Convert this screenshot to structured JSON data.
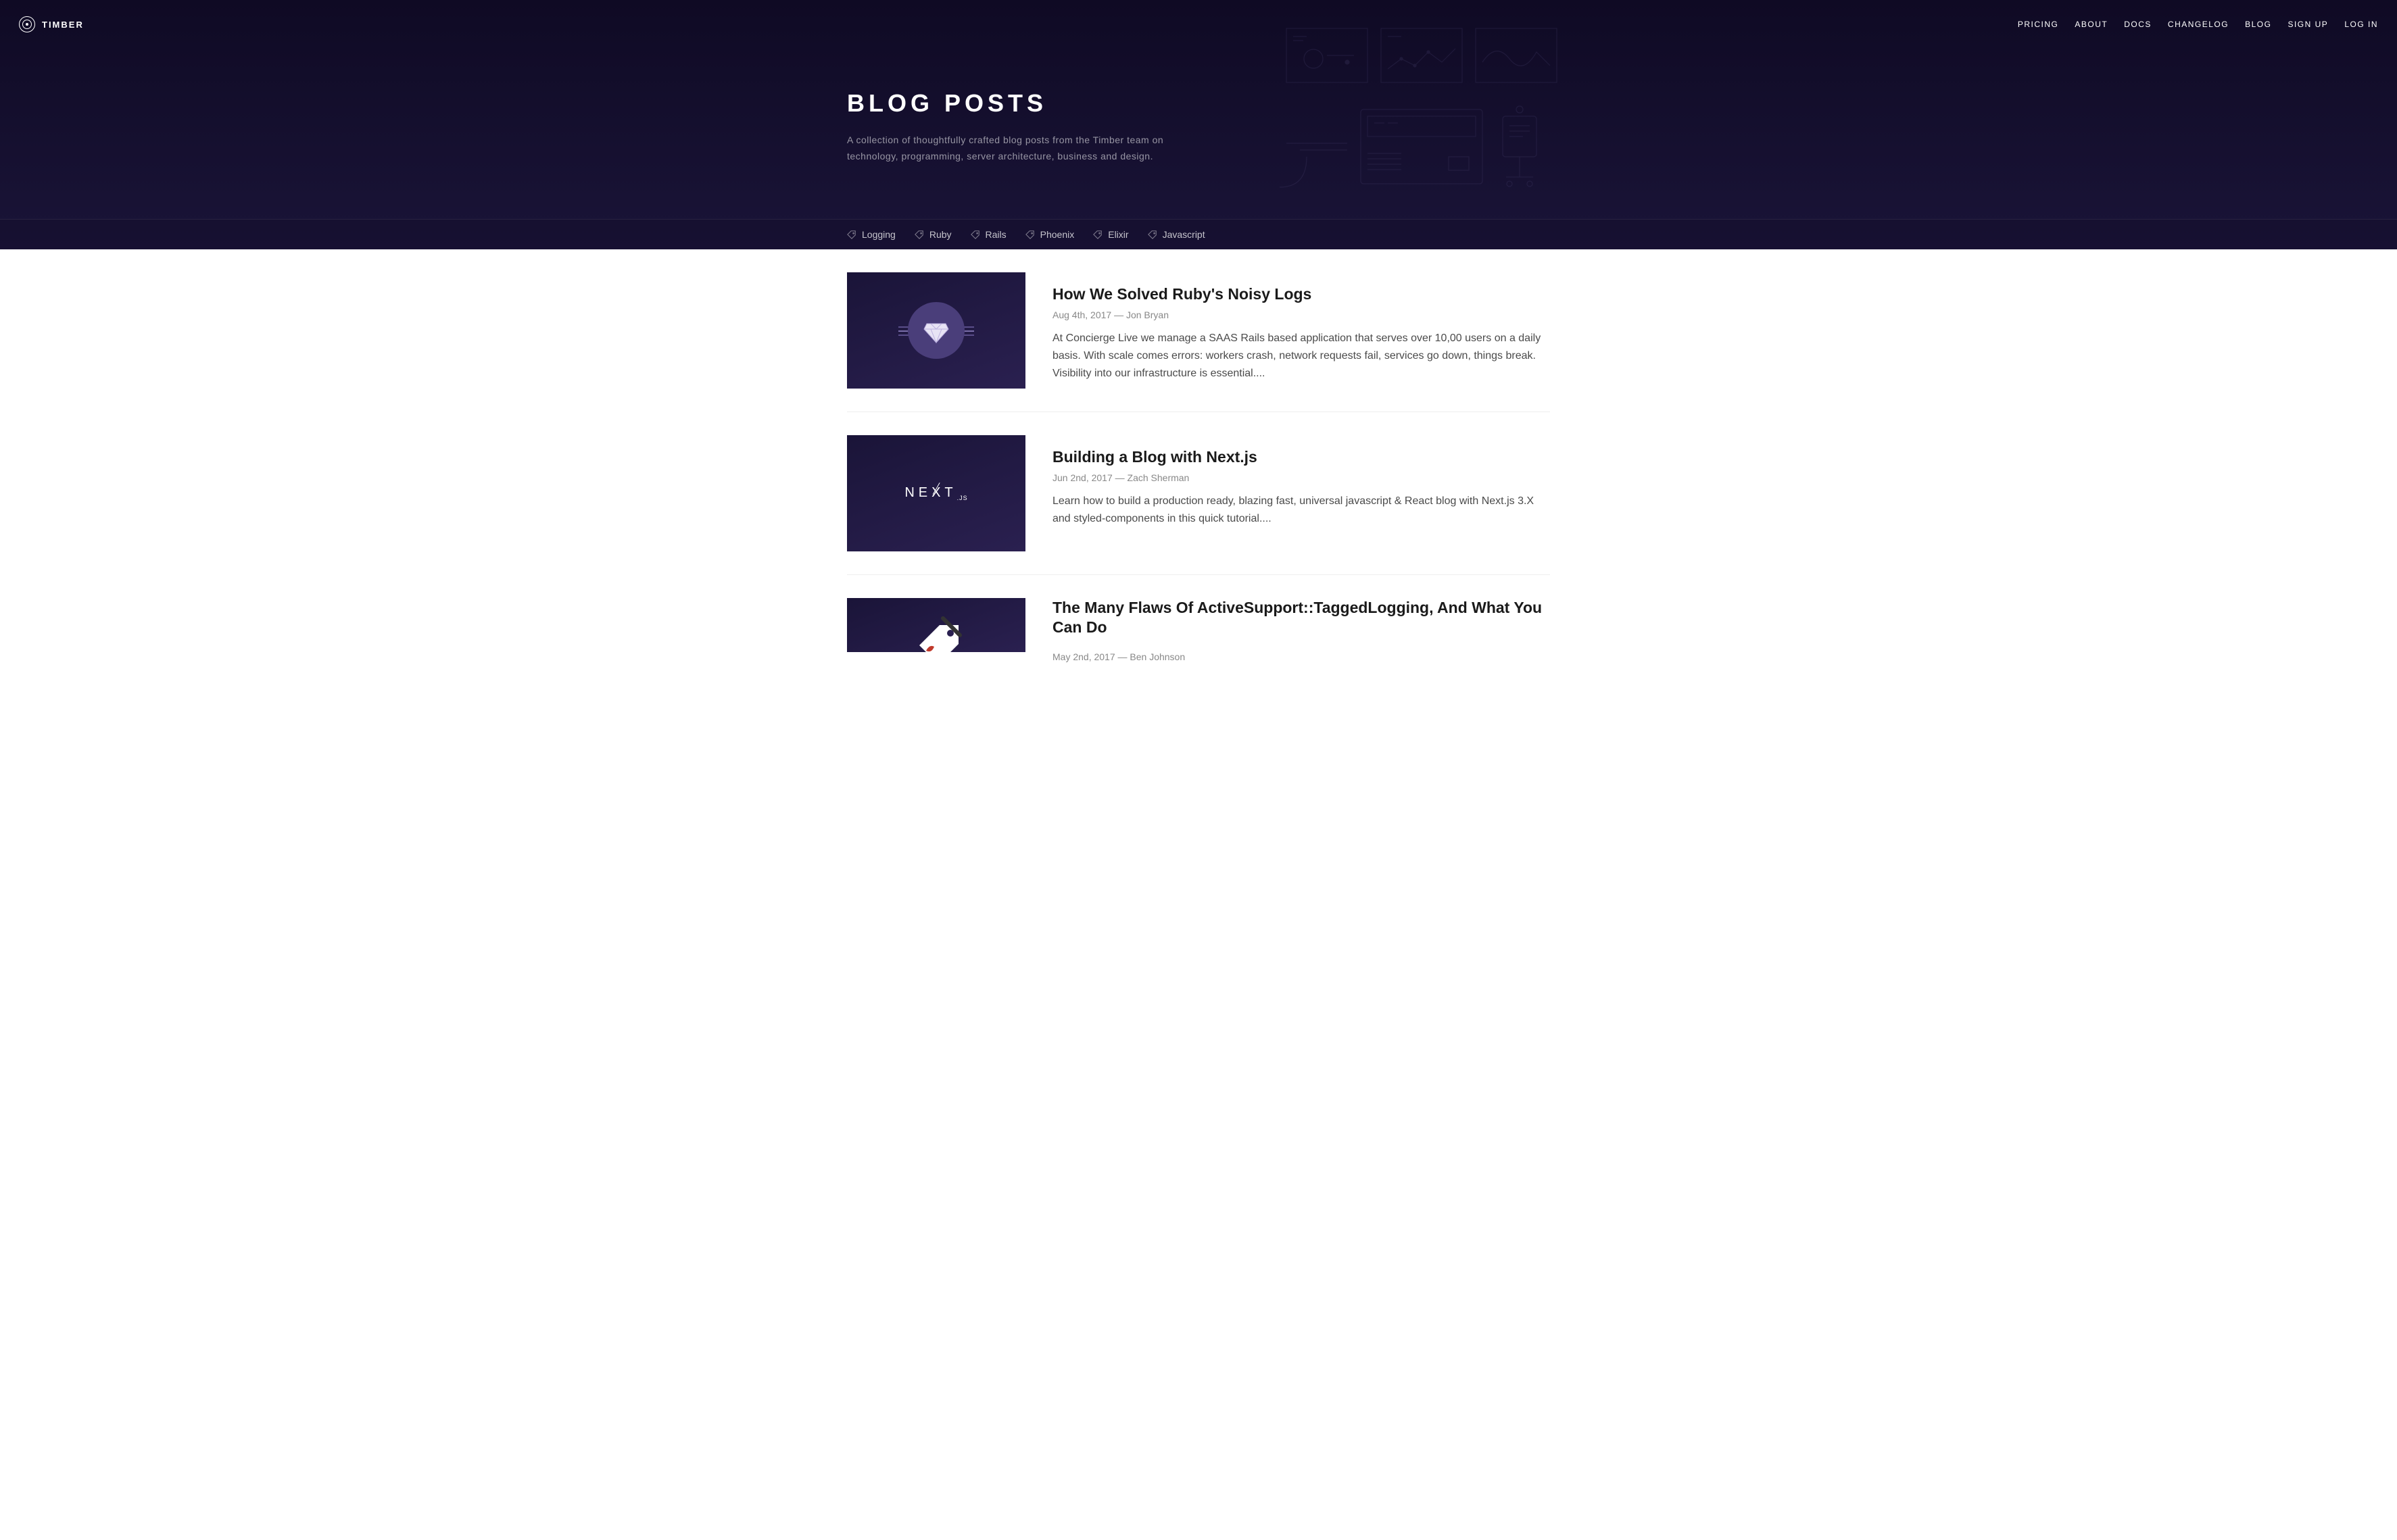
{
  "brand": "TIMBER",
  "nav": {
    "items": [
      {
        "label": "PRICING"
      },
      {
        "label": "ABOUT"
      },
      {
        "label": "DOCS"
      },
      {
        "label": "CHANGELOG"
      },
      {
        "label": "BLOG"
      },
      {
        "label": "SIGN UP"
      },
      {
        "label": "LOG IN"
      }
    ]
  },
  "hero": {
    "title": "BLOG POSTS",
    "subtitle": "A collection of thoughtfully crafted blog posts from the Timber team on technology, programming, server architecture, business and design."
  },
  "tags": [
    {
      "label": "Logging"
    },
    {
      "label": "Ruby"
    },
    {
      "label": "Rails"
    },
    {
      "label": "Phoenix"
    },
    {
      "label": "Elixir"
    },
    {
      "label": "Javascript"
    }
  ],
  "posts": [
    {
      "title": "How We Solved Ruby's Noisy Logs",
      "meta": "Aug 4th, 2017 — Jon Bryan",
      "excerpt": "At Concierge Live we manage a SAAS Rails based application that serves over 10,00 users on a daily basis. With scale comes errors: workers crash, network requests fail, services go down, things break. Visibility into our infrastructure is essential....",
      "thumb": "ruby"
    },
    {
      "title": "Building a Blog with Next.js",
      "meta": "Jun 2nd, 2017 — Zach Sherman",
      "excerpt": "Learn how to build a production ready, blazing fast, universal javascript & React blog with Next.js 3.X and styled-components in this quick tutorial....",
      "thumb": "next"
    },
    {
      "title": "The Many Flaws Of ActiveSupport::TaggedLogging, And What You Can Do",
      "meta": "May 2nd, 2017 — Ben Johnson",
      "excerpt": "",
      "thumb": "tag"
    }
  ]
}
